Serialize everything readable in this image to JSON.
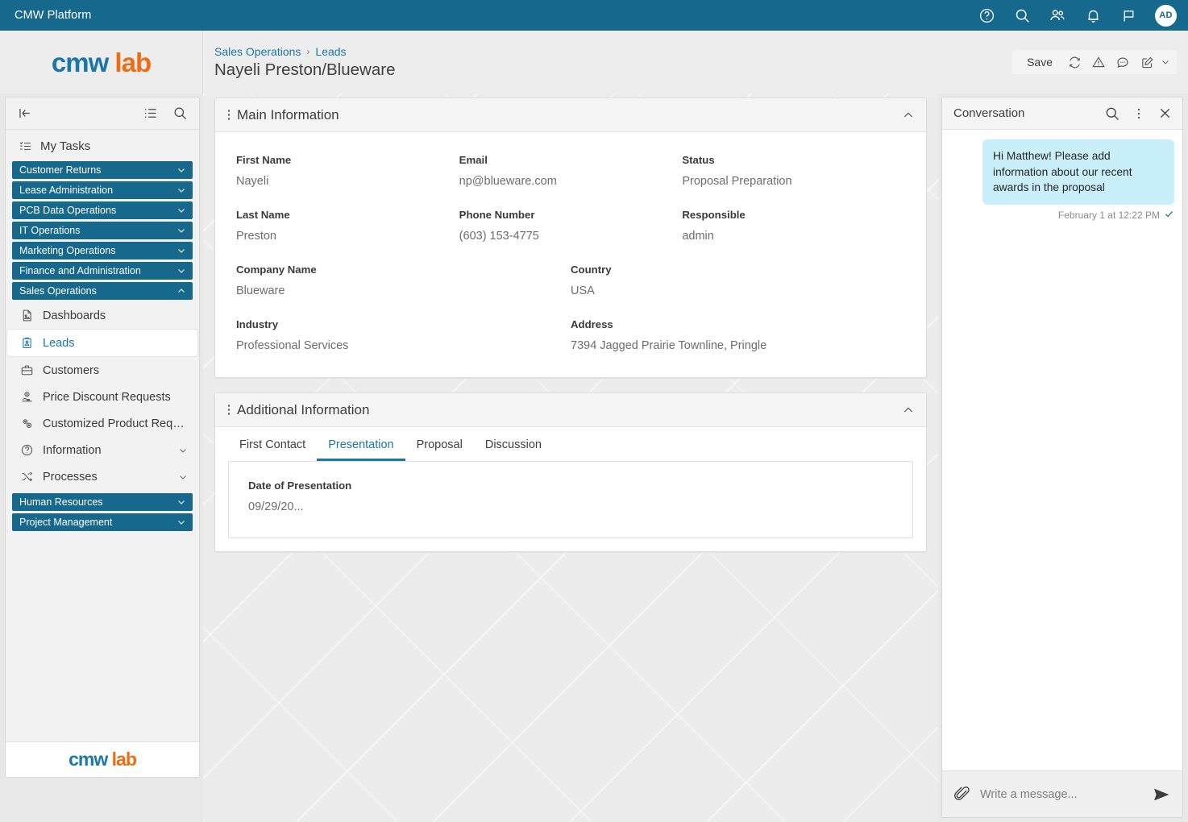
{
  "topbar": {
    "title": "CMW Platform",
    "icons": [
      "help-icon",
      "search-icon",
      "people-icon",
      "bell-icon",
      "flag-icon"
    ],
    "avatar_initials": "AD",
    "background_color": "#16688C"
  },
  "header": {
    "logo_part1": "cmw",
    "logo_part2": "lab",
    "breadcrumb": [
      {
        "label": "Sales Operations"
      },
      {
        "label": "Leads"
      }
    ],
    "breadcrumb_separator": "›",
    "record_title": "Nayeli Preston/Blueware",
    "actions": {
      "save_label": "Save",
      "icons": [
        "refresh-icon",
        "warning-icon",
        "comment-icon",
        "edit-icon"
      ],
      "caret": "⌄"
    }
  },
  "sidebar": {
    "collapse_label": "collapse-panel",
    "tool_icons": [
      "list-icon",
      "search-icon"
    ],
    "my_tasks_label": "My Tasks",
    "groups_top": [
      {
        "label": "Customer Returns",
        "expanded": false
      },
      {
        "label": "Lease Administration",
        "expanded": false
      },
      {
        "label": "PCB Data Operations",
        "expanded": false
      },
      {
        "label": "IT Operations",
        "expanded": false
      },
      {
        "label": "Marketing Operations",
        "expanded": false
      },
      {
        "label": "Finance and Administration",
        "expanded": false
      },
      {
        "label": "Sales Operations",
        "expanded": true
      }
    ],
    "items": [
      {
        "label": "Dashboards",
        "icon": "dashboard-icon",
        "active": false,
        "has_caret": false
      },
      {
        "label": "Leads",
        "icon": "leads-icon",
        "active": true,
        "has_caret": false
      },
      {
        "label": "Customers",
        "icon": "briefcase-icon",
        "active": false,
        "has_caret": false
      },
      {
        "label": "Price Discount Requests",
        "icon": "discount-icon",
        "active": false,
        "has_caret": false
      },
      {
        "label": "Customized Product Reque…",
        "icon": "gears-icon",
        "active": false,
        "has_caret": false
      },
      {
        "label": "Information",
        "icon": "info-icon",
        "active": false,
        "has_caret": true
      },
      {
        "label": "Processes",
        "icon": "processes-icon",
        "active": false,
        "has_caret": true
      }
    ],
    "groups_bottom": [
      {
        "label": "Human Resources",
        "expanded": false
      },
      {
        "label": "Project Management",
        "expanded": false
      }
    ],
    "footer_logo_part1": "cmw",
    "footer_logo_part2": "lab",
    "accent_color": "#16688C",
    "active_color": "#1B77A8"
  },
  "main": {
    "cards": [
      {
        "title": "Main Information",
        "collapsed": false,
        "rows": [
          [
            {
              "label": "First Name",
              "value": "Nayeli"
            },
            {
              "label": "Email",
              "value": "np@blueware.com"
            },
            {
              "label": "Status",
              "value": "Proposal Preparation"
            }
          ],
          [
            {
              "label": "Last Name",
              "value": "Preston"
            },
            {
              "label": "Phone Number",
              "value": "(603) 153-4775"
            },
            {
              "label": "Responsible",
              "value": "admin"
            }
          ]
        ],
        "rows_wide": [
          [
            {
              "label": "Company Name",
              "value": "Blueware"
            },
            {
              "label": "Country",
              "value": "USA"
            }
          ],
          [
            {
              "label": "Industry",
              "value": "Professional Services"
            },
            {
              "label": "Address",
              "value": "7394 Jagged Prairie Townline, Pringle"
            }
          ]
        ]
      },
      {
        "title": "Additional Information",
        "collapsed": false,
        "tabs": [
          {
            "label": "First Contact",
            "active": false
          },
          {
            "label": "Presentation",
            "active": true
          },
          {
            "label": "Proposal",
            "active": false
          },
          {
            "label": "Discussion",
            "active": false
          }
        ],
        "tab_content": {
          "label": "Date of Presentation",
          "value": "09/29/20..."
        }
      }
    ]
  },
  "conversation": {
    "title": "Conversation",
    "header_icons": [
      "search-icon",
      "kebab-icon",
      "close-icon"
    ],
    "messages": [
      {
        "text": "Hi Matthew! Please add information about our recent awards in the proposal",
        "timestamp": "February 1 at 12:22 PM",
        "status": "read",
        "bubble_color": "#C9EFFA"
      }
    ],
    "composer": {
      "placeholder": "Write a message...",
      "value": "",
      "attach_icon": "paperclip-icon",
      "send_icon": "send-icon"
    }
  }
}
